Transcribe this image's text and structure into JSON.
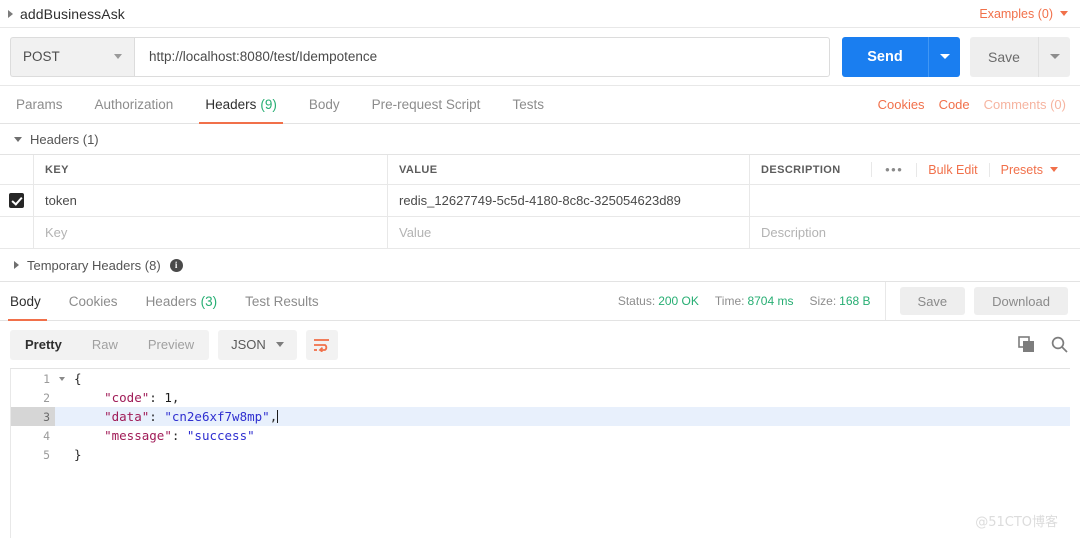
{
  "titlebar": {
    "request_name": "addBusinessAsk",
    "examples_label": "Examples (0)"
  },
  "urlbar": {
    "method": "POST",
    "url": "http://localhost:8080/test/Idempotence",
    "send_label": "Send",
    "save_label": "Save"
  },
  "request_tabs": [
    {
      "label": "Params",
      "count": "",
      "active": false
    },
    {
      "label": "Authorization",
      "count": "",
      "active": false
    },
    {
      "label": "Headers",
      "count": "(9)",
      "active": true
    },
    {
      "label": "Body",
      "count": "",
      "active": false
    },
    {
      "label": "Pre-request Script",
      "count": "",
      "active": false
    },
    {
      "label": "Tests",
      "count": "",
      "active": false
    }
  ],
  "request_tabs_right": [
    {
      "label": "Cookies",
      "muted": false
    },
    {
      "label": "Code",
      "muted": false
    },
    {
      "label": "Comments (0)",
      "muted": true
    }
  ],
  "headers_section": {
    "title": "Headers (1)",
    "temporary_title": "Temporary Headers (8)",
    "info_glyph": "i",
    "columns": {
      "key": "KEY",
      "value": "VALUE",
      "description": "DESCRIPTION"
    },
    "tools": {
      "dots": "•••",
      "bulk_edit": "Bulk Edit",
      "presets": "Presets"
    },
    "rows": [
      {
        "checked": true,
        "key": "token",
        "value": "redis_12627749-5c5d-4180-8c8c-325054623d89",
        "description": ""
      }
    ],
    "placeholder_row": {
      "key": "Key",
      "value": "Value",
      "description": "Description"
    }
  },
  "response": {
    "tabs": [
      {
        "label": "Body",
        "count": "",
        "active": true
      },
      {
        "label": "Cookies",
        "count": "",
        "active": false
      },
      {
        "label": "Headers",
        "count": "(3)",
        "active": false
      },
      {
        "label": "Test Results",
        "count": "",
        "active": false
      }
    ],
    "meta": {
      "status_label": "Status:",
      "status_value": "200 OK",
      "time_label": "Time:",
      "time_value": "8704 ms",
      "size_label": "Size:",
      "size_value": "168 B"
    },
    "buttons": {
      "save": "Save",
      "download": "Download"
    },
    "view_modes": [
      {
        "label": "Pretty",
        "active": true
      },
      {
        "label": "Raw",
        "active": false
      },
      {
        "label": "Preview",
        "active": false
      }
    ],
    "format": "JSON",
    "code_lines": [
      {
        "num": "1",
        "foldable": true,
        "highlight": false,
        "tokens": [
          {
            "t": "{",
            "c": "k-pun"
          }
        ]
      },
      {
        "num": "2",
        "foldable": false,
        "highlight": false,
        "tokens": [
          {
            "t": "    ",
            "c": "k-pun"
          },
          {
            "t": "\"code\"",
            "c": "k-key"
          },
          {
            "t": ": ",
            "c": "k-pun"
          },
          {
            "t": "1",
            "c": "k-num"
          },
          {
            "t": ",",
            "c": "k-pun"
          }
        ]
      },
      {
        "num": "3",
        "foldable": false,
        "highlight": true,
        "cursor": true,
        "tokens": [
          {
            "t": "    ",
            "c": "k-pun"
          },
          {
            "t": "\"data\"",
            "c": "k-key"
          },
          {
            "t": ": ",
            "c": "k-pun"
          },
          {
            "t": "\"cn2e6xf7w8mp\"",
            "c": "k-str"
          },
          {
            "t": ",",
            "c": "k-pun"
          }
        ]
      },
      {
        "num": "4",
        "foldable": false,
        "highlight": false,
        "tokens": [
          {
            "t": "    ",
            "c": "k-pun"
          },
          {
            "t": "\"message\"",
            "c": "k-key"
          },
          {
            "t": ": ",
            "c": "k-pun"
          },
          {
            "t": "\"success\"",
            "c": "k-str"
          }
        ]
      },
      {
        "num": "5",
        "foldable": false,
        "highlight": false,
        "tokens": [
          {
            "t": "}",
            "c": "k-pun"
          }
        ]
      }
    ]
  },
  "watermark": "@51CTO博客",
  "colors": {
    "accent_orange": "#f1704a",
    "send_blue": "#1a7ef0",
    "success_green": "#27ae73"
  }
}
